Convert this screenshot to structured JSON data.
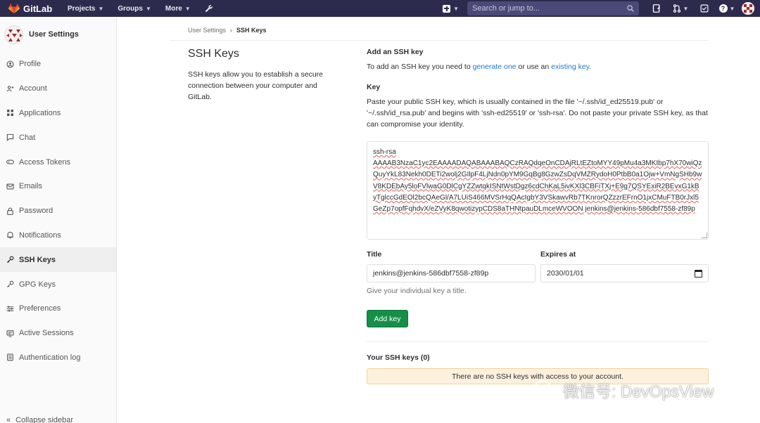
{
  "topnav": {
    "brand": "GitLab",
    "menus": [
      {
        "label": "Projects"
      },
      {
        "label": "Groups"
      },
      {
        "label": "More"
      }
    ],
    "search_placeholder": "Search or jump to..."
  },
  "sidebar": {
    "title": "User Settings",
    "items": [
      {
        "label": "Profile",
        "icon": "profile-icon"
      },
      {
        "label": "Account",
        "icon": "account-icon"
      },
      {
        "label": "Applications",
        "icon": "applications-icon"
      },
      {
        "label": "Chat",
        "icon": "chat-icon"
      },
      {
        "label": "Access Tokens",
        "icon": "token-icon"
      },
      {
        "label": "Emails",
        "icon": "email-icon"
      },
      {
        "label": "Password",
        "icon": "lock-icon"
      },
      {
        "label": "Notifications",
        "icon": "bell-icon"
      },
      {
        "label": "SSH Keys",
        "icon": "key-icon",
        "active": true
      },
      {
        "label": "GPG Keys",
        "icon": "key-icon"
      },
      {
        "label": "Preferences",
        "icon": "preferences-icon"
      },
      {
        "label": "Active Sessions",
        "icon": "monitor-icon"
      },
      {
        "label": "Authentication log",
        "icon": "log-icon"
      }
    ],
    "collapse": "Collapse sidebar"
  },
  "breadcrumb": {
    "parent": "User Settings",
    "separator": "›",
    "current": "SSH Keys"
  },
  "intro": {
    "title": "SSH Keys",
    "description": "SSH keys allow you to establish a secure connection between your computer and GitLab."
  },
  "form": {
    "heading": "Add an SSH key",
    "help_prefix": "To add an SSH key you need to ",
    "help_link1": "generate one",
    "help_mid": " or use an ",
    "help_link2": "existing key",
    "help_suffix": ".",
    "key_label": "Key",
    "key_help": "Paste your public SSH key, which is usually contained in the file '~/.ssh/id_ed25519.pub' or '~/.ssh/id_rsa.pub' and begins with 'ssh-ed25519' or 'ssh-rsa'. Do not paste your private SSH key, as that can compromise your identity.",
    "key_value_head": "ssh-rsa",
    "key_value_body": "AAAAB3NzaC1yc2EAAAADAQABAAABAQCzRAQdqeOnCDAjRLtEZtoMYY49pMu4a3MKIbp7hX70wiQzQuyYkL83Nekh0DETi2wolj2GIlpF4LjNdn0pYM9GqBg8GzwZsDqVMZRydoH0PtbB0a1Ojw+VmNgSHb9wV8KDEbAy5loFVlwaG0DlCgYZZwtqkISNtWstDgz6cdChKaL5ivKXl3CBFiTXj+E9g7QSYExiR2BEvxG1kByTglccGdEOl2bcQAeGl/A7LUiS466MVSrHqQAcIgbY3VSkawvRb7TKnrorQZzzrEFrnO1jxCMuFTB0rJxl5GeZp7opfFqhdvX/eZVyK8qwotizypCDS8aTHNtpauDLmceWVOON",
    "key_value_tail": " jenkins@jenkins-586dbf7558-zf89p",
    "title_label": "Title",
    "title_value": "jenkins@jenkins-586dbf7558-zf89p",
    "title_help": "Give your individual key a title.",
    "expires_label": "Expires at",
    "expires_value": "2030/01/01",
    "submit": "Add key"
  },
  "keys": {
    "heading": "Your SSH keys (0)",
    "empty": "There are no SSH keys with access to your account."
  },
  "watermark": "微信号: DevOpsView",
  "colors": {
    "nav_bg": "#2c2b4e",
    "primary_button": "#168f48",
    "link": "#1f78d1",
    "notice_bg": "#fdf1dd"
  }
}
